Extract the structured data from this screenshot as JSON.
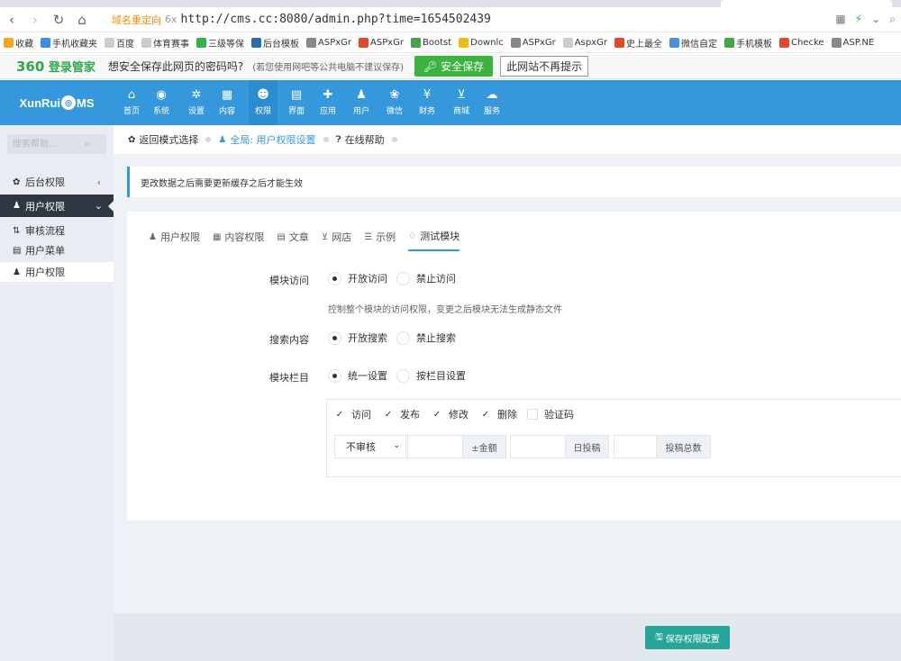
{
  "browser": {
    "redirect_tag": "域名重定向",
    "url_icon": "6x",
    "url": "http://cms.cc:8080/admin.php?time=1654502439",
    "right_icons": [
      "grid-icon",
      "bolt-icon",
      "chevron-down-icon",
      "search-icon"
    ],
    "bookmarks": [
      {
        "label": "收藏",
        "color": "#f5a623"
      },
      {
        "label": "手机收藏夹",
        "color": "#3b8ee8"
      },
      {
        "label": "百度",
        "color": "#cccccc"
      },
      {
        "label": "体育赛事",
        "color": "#cccccc"
      },
      {
        "label": "三级等保",
        "color": "#2fb34a"
      },
      {
        "label": "后台模板",
        "color": "#2b6cb0"
      },
      {
        "label": "ASPxGr",
        "color": "#888888"
      },
      {
        "label": "ASPxGr",
        "color": "#e4482a"
      },
      {
        "label": "Bootst",
        "color": "#48a14d"
      },
      {
        "label": "Downlc",
        "color": "#f1ba13"
      },
      {
        "label": "ASPxGr",
        "color": "#888888"
      },
      {
        "label": "AspxGr",
        "color": "#cccccc"
      },
      {
        "label": "史上最全",
        "color": "#e4482a"
      },
      {
        "label": "微信自定",
        "color": "#4a8fe0"
      },
      {
        "label": "手机模板",
        "color": "#41a848"
      },
      {
        "label": "Checke",
        "color": "#e4482a"
      },
      {
        "label": "ASP.NE",
        "color": "#888888"
      }
    ]
  },
  "password_bar": {
    "logo_num": "360",
    "logo_text": "登录管家",
    "question": "想安全保存此网页的密码吗?",
    "note": "(若您使用网吧等公共电脑不建议保存)",
    "save": "安全保存",
    "never": "此网站不再提示"
  },
  "brand": {
    "left": "XunRui",
    "right": "MS"
  },
  "topnav": [
    {
      "label": "首页",
      "icon": "home-icon",
      "glyph": "⌂"
    },
    {
      "label": "系统",
      "icon": "globe-icon",
      "glyph": "◉"
    },
    {
      "label": "设置",
      "icon": "gears-icon",
      "glyph": "✲"
    },
    {
      "label": "内容",
      "icon": "grid-icon",
      "glyph": "▦"
    },
    {
      "label": "权限",
      "icon": "user-circle-icon",
      "glyph": "☻"
    },
    {
      "label": "界面",
      "icon": "doc-icon",
      "glyph": "▤"
    },
    {
      "label": "应用",
      "icon": "puzzle-icon",
      "glyph": "✚"
    },
    {
      "label": "用户",
      "icon": "user-icon",
      "glyph": "♟"
    },
    {
      "label": "微信",
      "icon": "chat-icon",
      "glyph": "❀"
    },
    {
      "label": "财务",
      "icon": "yen-icon",
      "glyph": "¥"
    },
    {
      "label": "商城",
      "icon": "cart-icon",
      "glyph": "⊻"
    },
    {
      "label": "服务",
      "icon": "cloud-icon",
      "glyph": "☁"
    }
  ],
  "sidebar": {
    "search_placeholder": "搜索帮助...",
    "groups": [
      {
        "label": "后台权限",
        "icon": "gear-icon",
        "glyph": "✿",
        "arrow": "‹"
      },
      {
        "label": "用户权限",
        "icon": "user-icon",
        "glyph": "♟",
        "arrow": "⌄"
      }
    ],
    "items": [
      {
        "label": "审核流程",
        "icon": "sort-icon",
        "glyph": "⇅"
      },
      {
        "label": "用户菜单",
        "icon": "list-icon",
        "glyph": "▤"
      },
      {
        "label": "用户权限",
        "icon": "user-icon",
        "glyph": "♟"
      }
    ]
  },
  "breadcrumb": {
    "back": "返回模式选择",
    "current": "全局: 用户权限设置",
    "help": "在线帮助"
  },
  "notice": "更改数据之后需要更新缓存之后才能生效",
  "tabs": [
    {
      "label": "用户权限",
      "icon": "user-icon",
      "glyph": "♟"
    },
    {
      "label": "内容权限",
      "icon": "table-icon",
      "glyph": "▦"
    },
    {
      "label": "文章",
      "icon": "doc-icon",
      "glyph": "▤"
    },
    {
      "label": "网店",
      "icon": "cart-icon",
      "glyph": "⊻"
    },
    {
      "label": "示例",
      "icon": "list-icon",
      "glyph": "☰"
    },
    {
      "label": "测试模块",
      "icon": "diamond-icon",
      "glyph": "♢"
    }
  ],
  "form": {
    "access": {
      "label": "模块访问",
      "opt_on": "开放访问",
      "opt_off": "禁止访问",
      "help": "控制整个模块的访问权限，变更之后模块无法生成静态文件"
    },
    "search": {
      "label": "搜索内容",
      "opt_on": "开放搜索",
      "opt_off": "禁止搜索"
    },
    "category": {
      "label": "模块栏目",
      "opt_on": "统一设置",
      "opt_off": "按栏目设置"
    },
    "checks": [
      {
        "label": "访问",
        "checked": true
      },
      {
        "label": "发布",
        "checked": true
      },
      {
        "label": "修改",
        "checked": true
      },
      {
        "label": "删除",
        "checked": true
      },
      {
        "label": "验证码",
        "checked": false
      }
    ],
    "review_select": "不审核",
    "amount_addon": "±金额",
    "daily_addon": "日投稿",
    "total_addon": "投稿总数"
  },
  "save_button": "保存权限配置"
}
